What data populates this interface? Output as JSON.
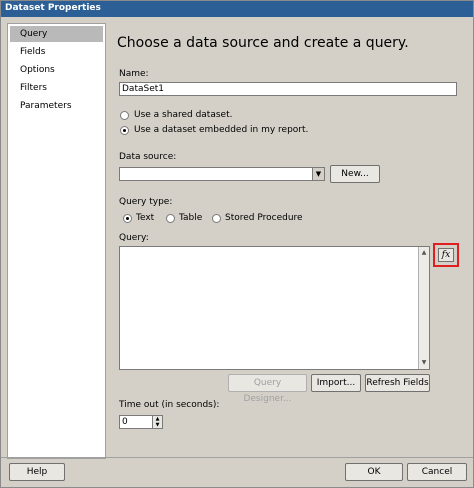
{
  "window": {
    "title": "Dataset Properties"
  },
  "sidebar": {
    "items": [
      {
        "label": "Query",
        "selected": true
      },
      {
        "label": "Fields"
      },
      {
        "label": "Options"
      },
      {
        "label": "Filters"
      },
      {
        "label": "Parameters"
      }
    ]
  },
  "main": {
    "heading": "Choose a data source and create a query.",
    "name_label": "Name:",
    "name_value": "DataSet1",
    "radio_shared": "Use a shared dataset.",
    "radio_embedded": "Use a dataset embedded in my report.",
    "datasource_label": "Data source:",
    "datasource_value": "",
    "new_button": "New...",
    "querytype_label": "Query type:",
    "qt_text": "Text",
    "qt_table": "Table",
    "qt_sp": "Stored Procedure",
    "query_label": "Query:",
    "query_value": "",
    "fx_label": "fx",
    "query_designer_button": "Query Designer...",
    "import_button": "Import...",
    "refresh_button": "Refresh Fields",
    "timeout_label": "Time out (in seconds):",
    "timeout_value": "0"
  },
  "footer": {
    "help": "Help",
    "ok": "OK",
    "cancel": "Cancel"
  }
}
